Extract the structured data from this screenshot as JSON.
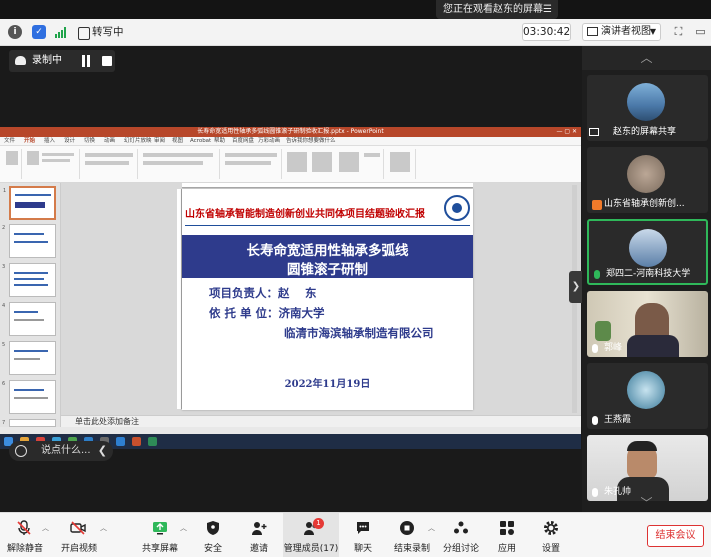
{
  "viewing_notice": "您正在观看赵东的屏幕",
  "topbar": {
    "transcribe_label": "转写中",
    "timer": "03:30:42",
    "view_label": "演讲者视图"
  },
  "recording": {
    "label": "录制中"
  },
  "shared_slide": {
    "window_title": "长寿命宽适用性轴承多弧线圆锥滚子研制验收汇报.pptx - PowerPoint",
    "ribbon_tabs": [
      "文件",
      "开始",
      "插入",
      "设计",
      "切换",
      "动画",
      "幻灯片放映",
      "审阅",
      "视图",
      "Acrobat",
      "帮助",
      "百度网盘",
      "万彩动画",
      "告诉我你想要做什么"
    ],
    "header": "山东省轴承智能制造创新创业共同体项目结题验收汇报",
    "title_line1": "长寿命宽适用性轴承多弧线",
    "title_line2": "圆锥滚子研制",
    "leader_line": "项目负责人：赵　 东",
    "org_line1": "依 托 单 位：济南大学",
    "org_line2": "临清市海滨轴承制造有限公司",
    "date": "2022年11月19日",
    "notes_placeholder": "单击此处添加备注",
    "thumb_numbers": [
      "1",
      "2",
      "3",
      "4",
      "5",
      "6",
      "7"
    ]
  },
  "chat": {
    "placeholder": "说点什么..."
  },
  "participants": [
    {
      "name": "赵东的屏幕共享",
      "type": "share",
      "avatar_color": "#4a78a8"
    },
    {
      "name": "山东省轴承创新创...",
      "type": "avatar",
      "avatar_color": "#7a6a5c"
    },
    {
      "name": "郑四二-河南科技大学",
      "type": "avatar",
      "active": true,
      "avatar_color": "#5b7fa8"
    },
    {
      "name": "郭峰",
      "type": "camera"
    },
    {
      "name": "王燕霞",
      "type": "avatar",
      "avatar_color": "#3a7a9a"
    },
    {
      "name": "朱孔帅",
      "type": "camera"
    }
  ],
  "toolbar": {
    "mute": "解除静音",
    "video": "开启视频",
    "share": "共享屏幕",
    "security": "安全",
    "invite": "邀请",
    "members": "管理成员(17)",
    "members_badge": "1",
    "chat": "聊天",
    "record": "结束录制",
    "breakout": "分组讨论",
    "apps": "应用",
    "settings": "设置",
    "end": "结束会议"
  },
  "colors": {
    "slide_blue": "#2e3b8c",
    "slide_red": "#c00000",
    "ppt_red": "#b7472a",
    "end_red": "#dd3333",
    "active_green": "#2fb85a"
  }
}
